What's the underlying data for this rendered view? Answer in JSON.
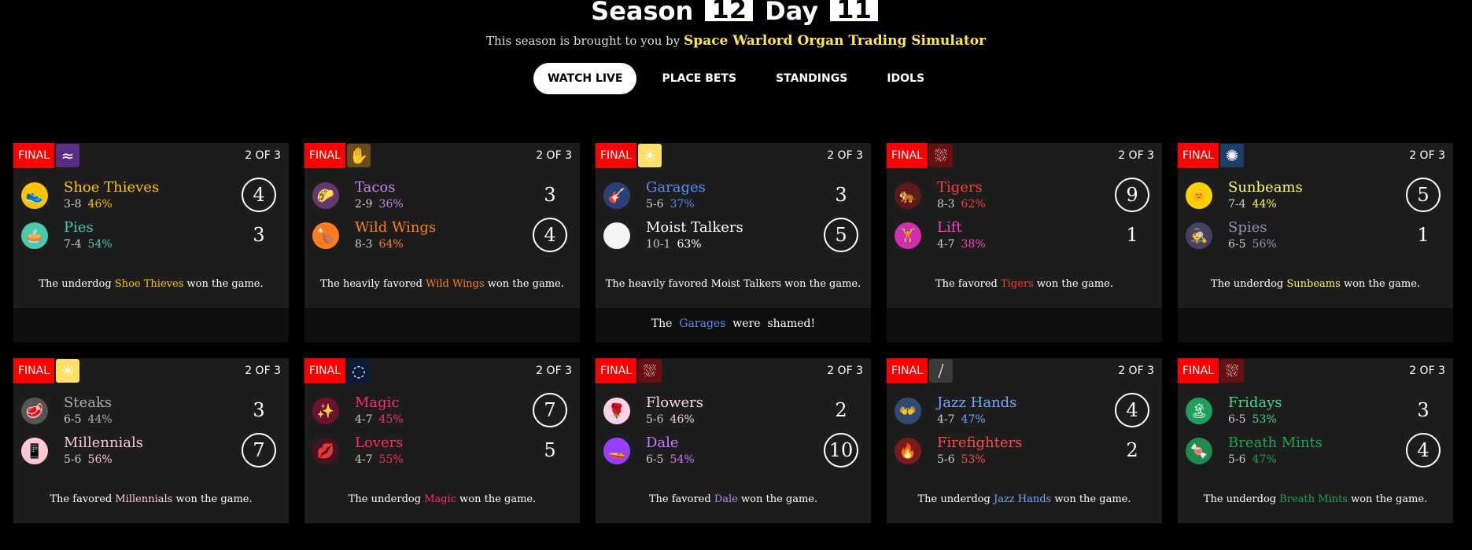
{
  "header": {
    "season_label": "Season",
    "season_num": "12",
    "day_label": "Day",
    "day_num": "11",
    "sponsor_prefix": "This season is brought to you by",
    "sponsor_name": "Space Warlord Organ Trading Simulator"
  },
  "nav": [
    {
      "label": "WATCH LIVE",
      "active": true
    },
    {
      "label": "PLACE BETS",
      "active": false
    },
    {
      "label": "STANDINGS",
      "active": false
    },
    {
      "label": "IDOLS",
      "active": false
    }
  ],
  "games": [
    {
      "status": "FINAL",
      "series": "2 OF 3",
      "weather_icon": "flooding-icon",
      "weather_glyph": "≈",
      "weather_bg": "#5a2d82",
      "teams": [
        {
          "name": "Shoe Thieves",
          "record": "3-8",
          "pct": "46%",
          "score": "4",
          "win": true,
          "color": "#ffc300",
          "emoji_bg": "#ffc300",
          "emoji": "👟"
        },
        {
          "name": "Pies",
          "record": "7-4",
          "pct": "54%",
          "score": "3",
          "win": false,
          "color": "#48c9b0",
          "emoji_bg": "#48c9b0",
          "emoji": "🥧"
        }
      ],
      "outcome": {
        "pre": "The underdog",
        "team": "Shoe Thieves",
        "color": "#ffc300",
        "post": "won the game."
      },
      "shame": null
    },
    {
      "status": "FINAL",
      "series": "2 OF 3",
      "weather_icon": "peanuts-icon",
      "weather_glyph": "✋",
      "weather_bg": "#6b4a1a",
      "teams": [
        {
          "name": "Tacos",
          "record": "2-9",
          "pct": "36%",
          "score": "3",
          "win": false,
          "color": "#c586f5",
          "emoji_bg": "#64376e",
          "emoji": "🌮"
        },
        {
          "name": "Wild Wings",
          "record": "8-3",
          "pct": "64%",
          "score": "4",
          "win": true,
          "color": "#ff7d1a",
          "emoji_bg": "#ff7d1a",
          "emoji": "🍗"
        }
      ],
      "outcome": {
        "pre": "The heavily favored",
        "team": "Wild Wings",
        "color": "#ff7d1a",
        "post": "won the game."
      },
      "shame": null
    },
    {
      "status": "FINAL",
      "series": "2 OF 3",
      "weather_icon": "sun-icon",
      "weather_glyph": "☀",
      "weather_bg": "#ffe066",
      "teams": [
        {
          "name": "Garages",
          "record": "5-6",
          "pct": "37%",
          "score": "3",
          "win": false,
          "color": "#5a8cff",
          "emoji_bg": "#2b4075",
          "emoji": "🎸"
        },
        {
          "name": "Moist Talkers",
          "record": "10-1",
          "pct": "63%",
          "score": "5",
          "win": true,
          "color": "#ffffff",
          "emoji_bg": "#f5f5f5",
          "emoji": ""
        }
      ],
      "outcome": {
        "pre": "The heavily favored",
        "team": "Moist Talkers",
        "color": "#ffffff",
        "post": "won the game."
      },
      "shame": {
        "pre": "The",
        "team": "Garages",
        "color": "#5a8cff",
        "post_a": "were",
        "post_b": "shamed!"
      }
    },
    {
      "status": "FINAL",
      "series": "2 OF 3",
      "weather_icon": "blooddrain-icon",
      "weather_glyph": "⛆",
      "weather_bg": "#6a0f0f",
      "teams": [
        {
          "name": "Tigers",
          "record": "8-3",
          "pct": "62%",
          "score": "9",
          "win": true,
          "color": "#ff3b30",
          "emoji_bg": "#5c1a1a",
          "emoji": "🐅"
        },
        {
          "name": "Lift",
          "record": "4-7",
          "pct": "38%",
          "score": "1",
          "win": false,
          "color": "#ff3fc1",
          "emoji_bg": "#d42cae",
          "emoji": "🏋"
        }
      ],
      "outcome": {
        "pre": "The favored",
        "team": "Tigers",
        "color": "#ff3b30",
        "post": "won the game."
      },
      "shame": null
    },
    {
      "status": "FINAL",
      "series": "2 OF 3",
      "weather_icon": "reverb-icon",
      "weather_glyph": "✺",
      "weather_bg": "#1b3f6b",
      "teams": [
        {
          "name": "Sunbeams",
          "record": "7-4",
          "pct": "44%",
          "score": "5",
          "win": true,
          "color": "#fff566",
          "emoji_bg": "#ffd000",
          "emoji": "🌞"
        },
        {
          "name": "Spies",
          "record": "6-5",
          "pct": "56%",
          "score": "1",
          "win": false,
          "color": "#9b8fbd",
          "emoji_bg": "#4a3f63",
          "emoji": "🕵"
        }
      ],
      "outcome": {
        "pre": "The underdog",
        "team": "Sunbeams",
        "color": "#fff566",
        "post": "won the game."
      },
      "shame": null
    },
    {
      "status": "FINAL",
      "series": "2 OF 3",
      "weather_icon": "sun-icon",
      "weather_glyph": "☀",
      "weather_bg": "#ffe066",
      "teams": [
        {
          "name": "Steaks",
          "record": "6-5",
          "pct": "44%",
          "score": "3",
          "win": false,
          "color": "#aaaaaa",
          "emoji_bg": "#555555",
          "emoji": "🥩"
        },
        {
          "name": "Millennials",
          "record": "5-6",
          "pct": "56%",
          "score": "7",
          "win": true,
          "color": "#ffc7d6",
          "emoji_bg": "#ffc7d6",
          "emoji": "📱"
        }
      ],
      "outcome": {
        "pre": "The favored",
        "team": "Millennials",
        "color": "#ffc7d6",
        "post": "won the game."
      },
      "shame": null
    },
    {
      "status": "FINAL",
      "series": "2 OF 3",
      "weather_icon": "eclipse-icon",
      "weather_glyph": "◌",
      "weather_bg": "#0a1a3a",
      "teams": [
        {
          "name": "Magic",
          "record": "4-7",
          "pct": "45%",
          "score": "7",
          "win": true,
          "color": "#ff2a6d",
          "emoji_bg": "#6b1230",
          "emoji": "✨"
        },
        {
          "name": "Lovers",
          "record": "4-7",
          "pct": "55%",
          "score": "5",
          "win": false,
          "color": "#ff2d55",
          "emoji_bg": "#4a1220",
          "emoji": "💋"
        }
      ],
      "outcome": {
        "pre": "The underdog",
        "team": "Magic",
        "color": "#ff2a6d",
        "post": "won the game."
      },
      "shame": null
    },
    {
      "status": "FINAL",
      "series": "2 OF 3",
      "weather_icon": "blooddrain-icon",
      "weather_glyph": "⛆",
      "weather_bg": "#6a0f0f",
      "teams": [
        {
          "name": "Flowers",
          "record": "5-6",
          "pct": "46%",
          "score": "2",
          "win": false,
          "color": "#ffd1e8",
          "emoji_bg": "#ffd1e8",
          "emoji": "🌹"
        },
        {
          "name": "Dale",
          "record": "6-5",
          "pct": "54%",
          "score": "10",
          "win": true,
          "color": "#c77dff",
          "emoji_bg": "#9b3dff",
          "emoji": "🚤"
        }
      ],
      "outcome": {
        "pre": "The favored",
        "team": "Dale",
        "color": "#c77dff",
        "post": "won the game."
      },
      "shame": null
    },
    {
      "status": "FINAL",
      "series": "2 OF 3",
      "weather_icon": "feedback-icon",
      "weather_glyph": "⧸",
      "weather_bg": "#3a3a3a",
      "teams": [
        {
          "name": "Jazz Hands",
          "record": "4-7",
          "pct": "47%",
          "score": "4",
          "win": true,
          "color": "#6fa8ff",
          "emoji_bg": "#2f4a75",
          "emoji": "👐"
        },
        {
          "name": "Firefighters",
          "record": "5-6",
          "pct": "53%",
          "score": "2",
          "win": false,
          "color": "#ff4a4a",
          "emoji_bg": "#7a1a1a",
          "emoji": "🔥"
        }
      ],
      "outcome": {
        "pre": "The underdog",
        "team": "Jazz Hands",
        "color": "#6fa8ff",
        "post": "won the game."
      },
      "shame": null
    },
    {
      "status": "FINAL",
      "series": "2 OF 3",
      "weather_icon": "blooddrain-icon",
      "weather_glyph": "⛆",
      "weather_bg": "#6a0f0f",
      "teams": [
        {
          "name": "Fridays",
          "record": "6-5",
          "pct": "53%",
          "score": "3",
          "win": false,
          "color": "#3ddc84",
          "emoji_bg": "#1fa05a",
          "emoji": "🏝"
        },
        {
          "name": "Breath Mints",
          "record": "5-6",
          "pct": "47%",
          "score": "4",
          "win": true,
          "color": "#20a34f",
          "emoji_bg": "#1f8a4c",
          "emoji": "🍬"
        }
      ],
      "outcome": {
        "pre": "The underdog",
        "team": "Breath Mints",
        "color": "#20a34f",
        "post": "won the game."
      },
      "shame": null
    }
  ]
}
